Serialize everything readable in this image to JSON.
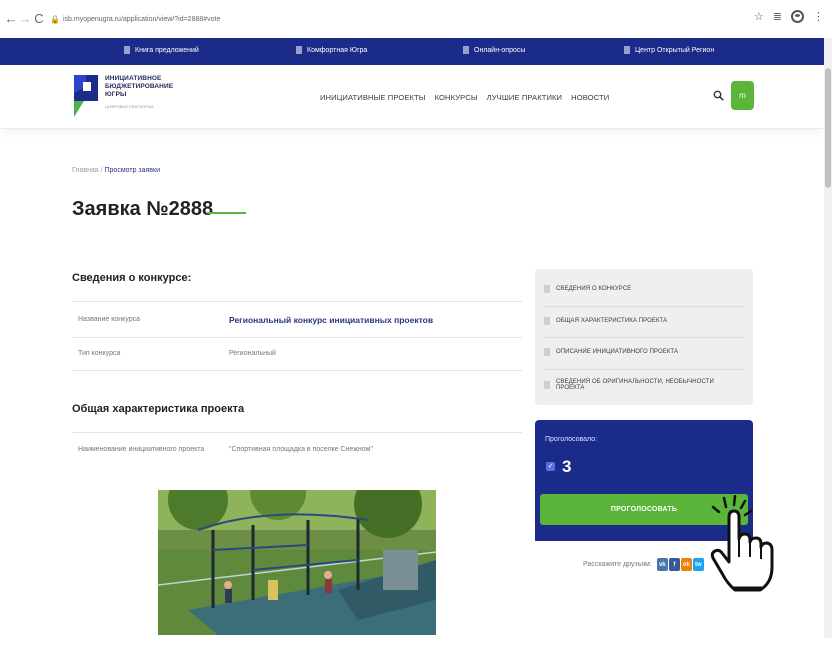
{
  "browser": {
    "url": "isb.myopenugra.ru/application/view/?id=2888#vote",
    "back_icon": "←",
    "forward_icon": "→",
    "reload_icon": "C",
    "star_icon": "☆",
    "menu_icon": "⋮"
  },
  "topbar": {
    "items": [
      {
        "label": "Книга предложений"
      },
      {
        "label": "Комфортная Югра"
      },
      {
        "label": "Онлайн-опросы"
      },
      {
        "label": "Центр Открытый Регион"
      }
    ]
  },
  "header": {
    "logo_lines": [
      "ИНИЦИАТИВНОЕ",
      "БЮДЖЕТИРОВАНИЕ",
      "ЮГРЫ"
    ],
    "logo_subtext": "ЦИФРОВАЯ ПЛАТФОРМА",
    "nav": [
      {
        "label": "ИНИЦИАТИВНЫЕ ПРОЕКТЫ"
      },
      {
        "label": "КОНКУРСЫ"
      },
      {
        "label": "ЛУЧШИЕ ПРАКТИКИ"
      },
      {
        "label": "НОВОСТИ"
      }
    ],
    "avatar_letter": "m"
  },
  "breadcrumb": {
    "home": "Главная",
    "separator": " / ",
    "current": "Просмотр заявки"
  },
  "page_title": "Заявка №2888",
  "contest_section": {
    "title": "Сведения о конкурсе:",
    "rows": [
      {
        "label": "Название конкурса",
        "value": "Региональный конкурс инициативных проектов"
      },
      {
        "label": "Тип конкурса",
        "value": "Региональный"
      }
    ]
  },
  "general_section": {
    "title": "Общая характеристика проекта",
    "rows": [
      {
        "label": "Наименование инициативного проекта",
        "value": "\"Спортивная площадка в поселке Снежном\""
      }
    ]
  },
  "side_nav": {
    "items": [
      {
        "label": "СВЕДЕНИЯ О КОНКУРСЕ"
      },
      {
        "label": "ОБЩАЯ ХАРАКТЕРИСТИКА ПРОЕКТА"
      },
      {
        "label": "ОПИСАНИЕ ИНИЦИАТИВНОГО ПРОЕКТА"
      },
      {
        "label": "СВЕДЕНИЯ ОБ ОРИГИНАЛЬНОСТИ, НЕОБЫЧНОСТИ ПРОЕКТА"
      }
    ]
  },
  "vote": {
    "label": "Проголосовало:",
    "count": "3",
    "button_label": "ПРОГОЛОСОВАТЬ"
  },
  "share": {
    "label": "Расскажите друзьям:",
    "buttons": [
      {
        "text": "vk",
        "color": "#4a76a8"
      },
      {
        "text": "f",
        "color": "#3b5998"
      },
      {
        "text": "ok",
        "color": "#ee8208"
      },
      {
        "text": "tw",
        "color": "#1da1f2"
      }
    ]
  },
  "colors": {
    "brand_blue": "#1a2b8a",
    "accent_green": "#5ab53a",
    "link_blue": "#2a3580"
  }
}
